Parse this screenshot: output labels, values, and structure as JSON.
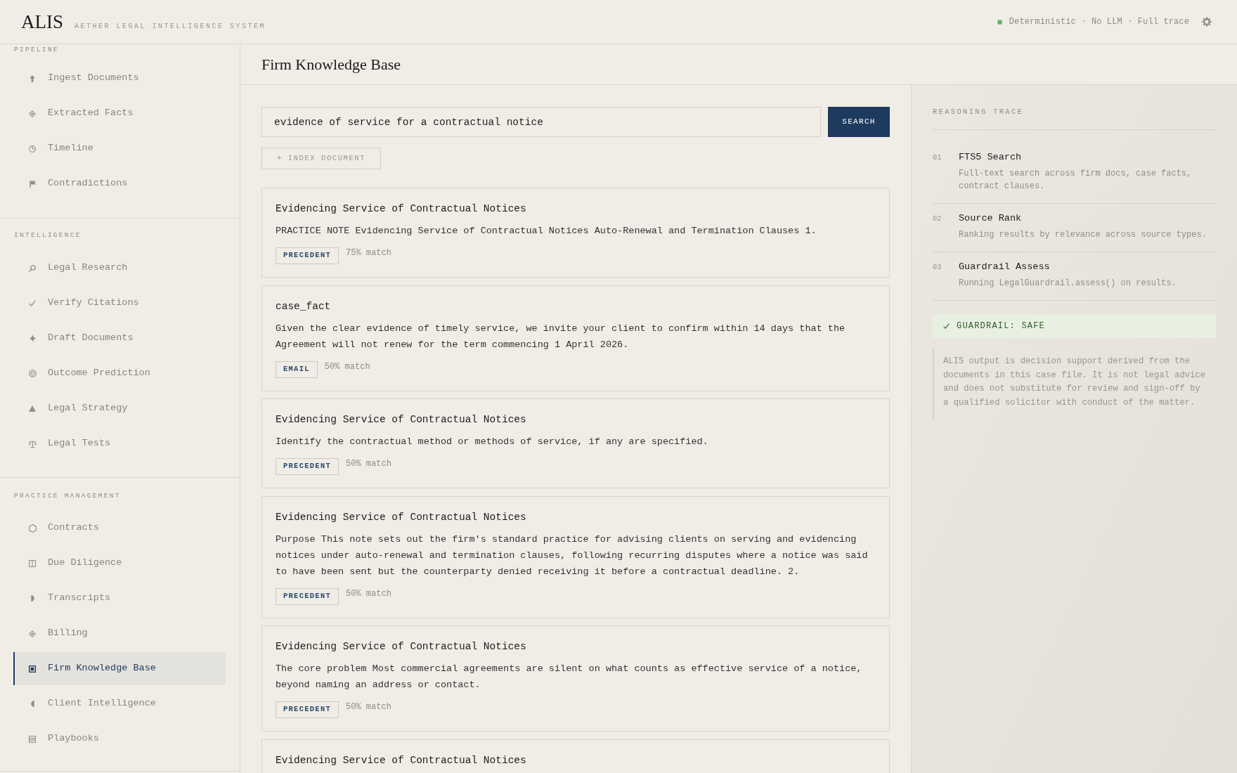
{
  "header": {
    "logo": "ALIS",
    "subtitle": "AETHER LEGAL INTELLIGENCE SYSTEM",
    "status": "Deterministic · No LLM · Full trace"
  },
  "sidebar": {
    "sections": [
      {
        "label": "PIPELINE",
        "items": [
          {
            "label": "Ingest Documents",
            "selected": false
          },
          {
            "label": "Extracted Facts",
            "selected": false
          },
          {
            "label": "Timeline",
            "selected": false
          },
          {
            "label": "Contradictions",
            "selected": false
          }
        ]
      },
      {
        "label": "INTELLIGENCE",
        "items": [
          {
            "label": "Legal Research",
            "selected": false
          },
          {
            "label": "Verify Citations",
            "selected": false
          },
          {
            "label": "Draft Documents",
            "selected": false
          },
          {
            "label": "Outcome Prediction",
            "selected": false
          },
          {
            "label": "Legal Strategy",
            "selected": false
          },
          {
            "label": "Legal Tests",
            "selected": false
          }
        ]
      },
      {
        "label": "PRACTICE MANAGEMENT",
        "items": [
          {
            "label": "Contracts",
            "selected": false
          },
          {
            "label": "Due Diligence",
            "selected": false
          },
          {
            "label": "Transcripts",
            "selected": false
          },
          {
            "label": "Billing",
            "selected": false
          },
          {
            "label": "Firm Knowledge Base",
            "selected": true
          },
          {
            "label": "Client Intelligence",
            "selected": false
          },
          {
            "label": "Playbooks",
            "selected": false
          }
        ]
      }
    ]
  },
  "page": {
    "title": "Firm Knowledge Base",
    "search": {
      "value": "evidence of service for a contractual notice",
      "button": "SEARCH"
    },
    "index_button": "+ INDEX DOCUMENT",
    "results": [
      {
        "title": "Evidencing Service of Contractual Notices",
        "snippet": "PRACTICE NOTE Evidencing Service of Contractual Notices Auto-Renewal and Termination Clauses 1.",
        "tag": "PRECEDENT",
        "match": "75% match"
      },
      {
        "title": "case_fact",
        "snippet": "Given the clear evidence of timely service, we invite your client to confirm within 14 days that the Agreement will not renew for the term commencing 1 April 2026.",
        "tag": "EMAIL",
        "match": "50% match"
      },
      {
        "title": "Evidencing Service of Contractual Notices",
        "snippet": "Identify the contractual method or methods of service, if any are specified.",
        "tag": "PRECEDENT",
        "match": "50% match"
      },
      {
        "title": "Evidencing Service of Contractual Notices",
        "snippet": "Purpose This note sets out the firm's standard practice for advising clients on serving and evidencing notices under auto-renewal and termination clauses, following recurring disputes where a notice was said to have been sent but the counterparty denied receiving it before a contractual deadline. 2.",
        "tag": "PRECEDENT",
        "match": "50% match"
      },
      {
        "title": "Evidencing Service of Contractual Notices",
        "snippet": "The core problem Most commercial agreements are silent on what counts as effective service of a notice, beyond naming an address or contact.",
        "tag": "PRECEDENT",
        "match": "50% match"
      },
      {
        "title": "Evidencing Service of Contractual Notices"
      }
    ]
  },
  "trace": {
    "heading": "REASONING TRACE",
    "steps": [
      {
        "number": "01",
        "title": "FTS5 Search",
        "description": "Full-text search across firm docs, case facts, contract clauses."
      },
      {
        "number": "02",
        "title": "Source Rank",
        "description": "Ranking results by relevance across source types."
      },
      {
        "number": "03",
        "title": "Guardrail Assess",
        "description": "Running LegalGuardrail.assess() on results."
      }
    ],
    "guardrail": "GUARDRAIL: SAFE",
    "disclaimer": "ALIS output is decision support derived from the documents in this case file. It is not legal advice and does not substitute for review and sign-off by a qualified solicitor with conduct of the matter."
  }
}
